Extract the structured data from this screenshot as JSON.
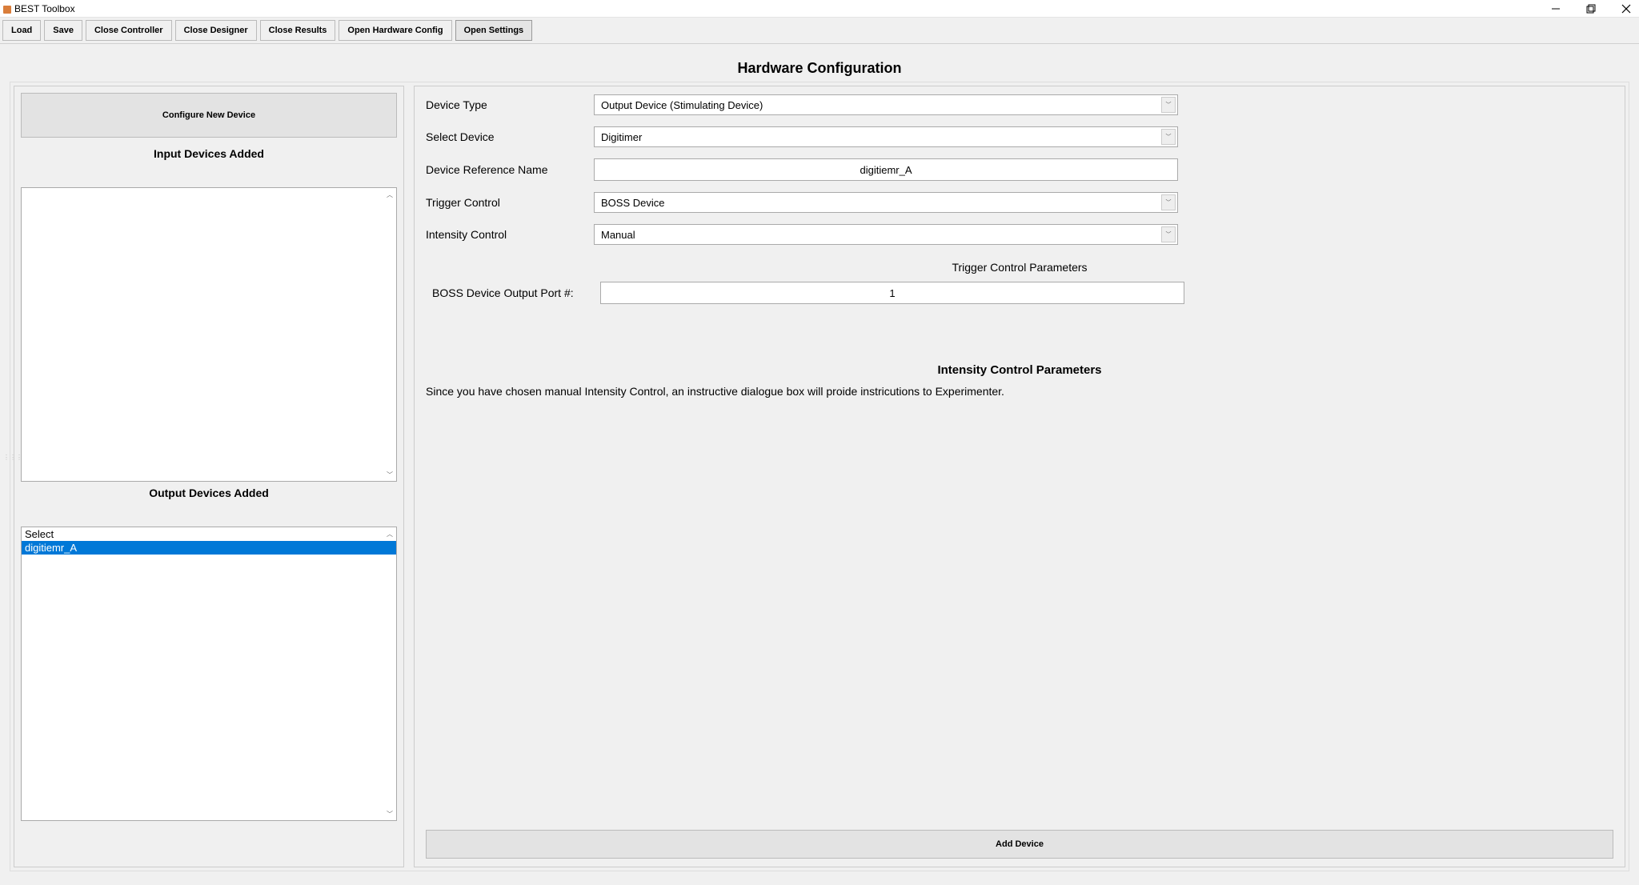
{
  "window": {
    "title": "BEST Toolbox"
  },
  "toolbar": {
    "load": "Load",
    "save": "Save",
    "close_controller": "Close Controller",
    "close_designer": "Close Designer",
    "close_results": "Close Results",
    "open_hardware_config": "Open Hardware Config",
    "open_settings": "Open Settings"
  },
  "page": {
    "title": "Hardware Configuration"
  },
  "left": {
    "configure_new_device": "Configure New Device",
    "input_devices_label": "Input Devices Added",
    "output_devices_label": "Output Devices Added",
    "output_list": {
      "item0": "Select",
      "item1": "digitiemr_A"
    }
  },
  "form": {
    "device_type_label": "Device Type",
    "device_type_value": "Output Device (Stimulating Device)",
    "select_device_label": "Select Device",
    "select_device_value": "Digitimer",
    "device_ref_label": "Device Reference Name",
    "device_ref_value": "digitiemr_A",
    "trigger_control_label": "Trigger Control",
    "trigger_control_value": "BOSS Device",
    "intensity_control_label": "Intensity Control",
    "intensity_control_value": "Manual",
    "trigger_params_heading": "Trigger Control Parameters",
    "boss_port_label": "BOSS Device Output Port #:",
    "boss_port_value": "1",
    "intensity_params_heading": "Intensity Control Parameters",
    "intensity_instruction": "Since you have chosen manual Intensity Control, an instructive dialogue box will proide instricutions to Experimenter.",
    "add_device": "Add Device"
  }
}
